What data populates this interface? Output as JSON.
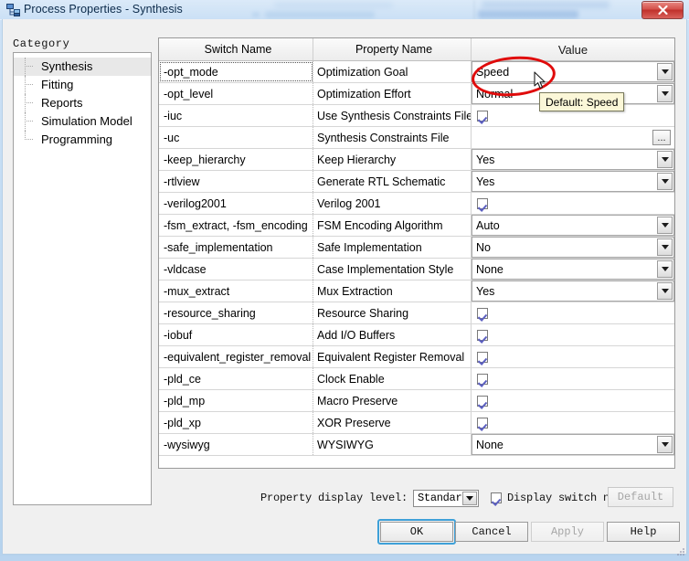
{
  "window": {
    "title": "Process Properties - Synthesis",
    "title_icon": "hierarchy-icon",
    "close_icon": "close-icon",
    "close_label": "Close"
  },
  "category": {
    "label": "Category",
    "items": [
      {
        "label": "Synthesis",
        "selected": true
      },
      {
        "label": "Fitting",
        "selected": false
      },
      {
        "label": "Reports",
        "selected": false
      },
      {
        "label": "Simulation Model",
        "selected": false
      },
      {
        "label": "Programming",
        "selected": false
      }
    ]
  },
  "grid": {
    "columns": [
      "Switch Name",
      "Property Name",
      "Value"
    ],
    "rows": [
      {
        "switch": "-opt_mode",
        "property": "Optimization Goal",
        "kind": "combo",
        "value": "Speed",
        "focused": true
      },
      {
        "switch": "-opt_level",
        "property": "Optimization Effort",
        "kind": "combo",
        "value": "Normal",
        "focused": false
      },
      {
        "switch": "-iuc",
        "property": "Use Synthesis Constraints File",
        "kind": "checkbox",
        "value": "checked",
        "focused": false
      },
      {
        "switch": "-uc",
        "property": "Synthesis Constraints File",
        "kind": "browse",
        "value": "",
        "browse_label": "...",
        "focused": false
      },
      {
        "switch": "-keep_hierarchy",
        "property": "Keep Hierarchy",
        "kind": "combo",
        "value": "Yes",
        "focused": false
      },
      {
        "switch": "-rtlview",
        "property": "Generate RTL Schematic",
        "kind": "combo",
        "value": "Yes",
        "focused": false
      },
      {
        "switch": "-verilog2001",
        "property": "Verilog 2001",
        "kind": "checkbox",
        "value": "checked",
        "focused": false
      },
      {
        "switch": "-fsm_extract, -fsm_encoding",
        "property": "FSM Encoding Algorithm",
        "kind": "combo",
        "value": "Auto",
        "focused": false
      },
      {
        "switch": "-safe_implementation",
        "property": "Safe Implementation",
        "kind": "combo",
        "value": "No",
        "focused": false
      },
      {
        "switch": "-vldcase",
        "property": "Case Implementation Style",
        "kind": "combo",
        "value": "None",
        "focused": false
      },
      {
        "switch": "-mux_extract",
        "property": "Mux Extraction",
        "kind": "combo",
        "value": "Yes",
        "focused": false
      },
      {
        "switch": "-resource_sharing",
        "property": "Resource Sharing",
        "kind": "checkbox",
        "value": "checked",
        "focused": false
      },
      {
        "switch": "-iobuf",
        "property": "Add I/O Buffers",
        "kind": "checkbox",
        "value": "checked",
        "focused": false
      },
      {
        "switch": "-equivalent_register_removal",
        "property": "Equivalent Register Removal",
        "kind": "checkbox",
        "value": "checked",
        "focused": false
      },
      {
        "switch": "-pld_ce",
        "property": "Clock Enable",
        "kind": "checkbox",
        "value": "checked",
        "focused": false
      },
      {
        "switch": "-pld_mp",
        "property": "Macro Preserve",
        "kind": "checkbox",
        "value": "checked",
        "focused": false
      },
      {
        "switch": "-pld_xp",
        "property": "XOR Preserve",
        "kind": "checkbox",
        "value": "checked",
        "focused": false
      },
      {
        "switch": "-wysiwyg",
        "property": "WYSIWYG",
        "kind": "combo",
        "value": "None",
        "focused": false
      }
    ]
  },
  "tooltip": {
    "text": "Default: Speed"
  },
  "annotation": {
    "shape": "red-ellipse",
    "color": "#e00b0b",
    "targets": "Speed"
  },
  "cursor": {
    "type": "arrow-pointer"
  },
  "options": {
    "display_level_label": "Property display level:",
    "display_level_value": "Standard",
    "switch_names_label": "Display switch names",
    "switch_names_checked": true,
    "default_button": "Default",
    "default_button_enabled": false
  },
  "buttons": {
    "ok": "OK",
    "cancel": "Cancel",
    "apply": "Apply",
    "apply_enabled": false,
    "help": "Help",
    "focused": "OK"
  }
}
